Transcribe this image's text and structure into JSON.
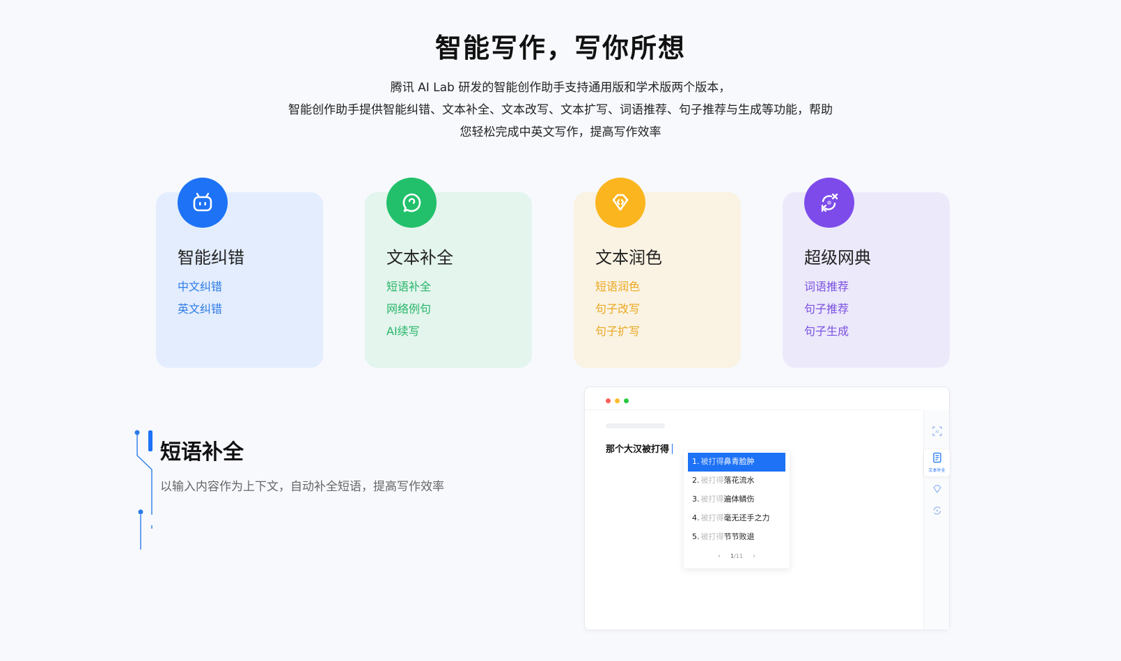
{
  "hero": {
    "title": "智能写作，写你所想",
    "desc_lines": [
      "腾讯 AI Lab 研发的智能创作助手支持通用版和学术版两个版本，",
      "智能创作助手提供智能纠错、文本补全、文本改写、文本扩写、词语推荐、句子推荐与生成等功能，帮助",
      "您轻松完成中英文写作，提高写作效率"
    ]
  },
  "cards": [
    {
      "title": "智能纠错",
      "icon": "robot-face-icon",
      "color": "#1d72f5",
      "items": [
        "中文纠错",
        "英文纠错"
      ]
    },
    {
      "title": "文本补全",
      "icon": "chat-bubble-icon",
      "color": "#22c06b",
      "items": [
        "短语补全",
        "网络例句",
        "AI续写"
      ]
    },
    {
      "title": "文本润色",
      "icon": "diamond-tag-icon",
      "color": "#fbb51f",
      "items": [
        "短语润色",
        "句子改写",
        "句子扩写"
      ]
    },
    {
      "title": "超级网典",
      "icon": "xk-cycle-icon",
      "color": "#7d4bea",
      "items": [
        "词语推荐",
        "句子推荐",
        "句子生成"
      ]
    }
  ],
  "feature": {
    "title": "短语补全",
    "desc": "以输入内容作为上下文，自动补全短语，提高写作效率"
  },
  "demo": {
    "window_dots": [
      "#ff5f57",
      "#febc2e",
      "#28c840"
    ],
    "editor_text": "那个大汉被打得",
    "suggestions": [
      {
        "num": "1.",
        "prefix": "被打得",
        "text": "鼻青脸肿"
      },
      {
        "num": "2.",
        "prefix": "被打得",
        "text": "落花流水"
      },
      {
        "num": "3.",
        "prefix": "被打得",
        "text": "遍体鳞伤"
      },
      {
        "num": "4.",
        "prefix": "被打得",
        "text": "毫无还手之力"
      },
      {
        "num": "5.",
        "prefix": "被打得",
        "text": "节节败退"
      }
    ],
    "pager": {
      "prev": "‹",
      "current": "1",
      "sep": "/",
      "total": "11",
      "next": "›"
    },
    "rail": {
      "scan_icon": "ai-scan-icon",
      "active_label": "文本补全",
      "active_icon": "document-icon",
      "tag_icon": "diamond-outline-icon",
      "cycle_icon": "cycle-icon"
    }
  }
}
